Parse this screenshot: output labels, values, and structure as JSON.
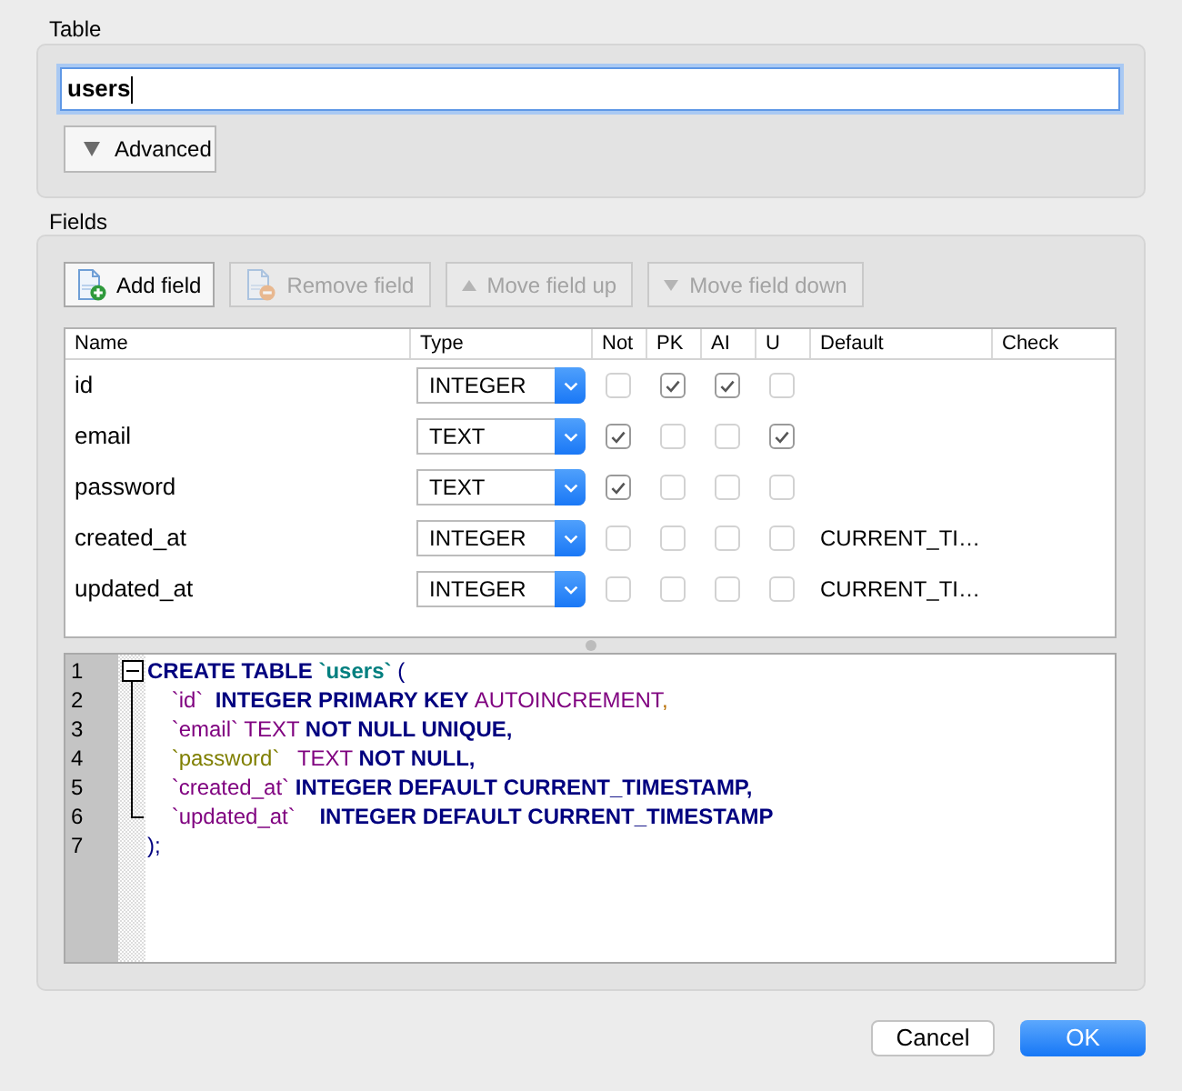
{
  "table_section": {
    "label": "Table",
    "name_field": {
      "value": "users",
      "focused": true
    },
    "advanced_button": {
      "label": "Advanced"
    }
  },
  "fields_section": {
    "label": "Fields",
    "toolbar": [
      {
        "kind": "add",
        "label": "Add field",
        "disabled": false
      },
      {
        "kind": "remove",
        "label": "Remove field",
        "disabled": true
      },
      {
        "kind": "up",
        "label": "Move field up",
        "disabled": true
      },
      {
        "kind": "down",
        "label": "Move field down",
        "disabled": true
      }
    ],
    "columns": [
      "Name",
      "Type",
      "Not",
      "PK",
      "AI",
      "U",
      "Default",
      "Check"
    ],
    "rows": [
      {
        "name": "id",
        "type": "INTEGER",
        "not_null": false,
        "pk": true,
        "ai": true,
        "unique": false
      },
      {
        "name": "email",
        "type": "TEXT",
        "not_null": true,
        "pk": false,
        "ai": false,
        "unique": true
      },
      {
        "name": "password",
        "type": "TEXT",
        "not_null": true,
        "pk": false,
        "ai": false,
        "unique": false
      },
      {
        "name": "created_at",
        "type": "INTEGER",
        "not_null": false,
        "pk": false,
        "ai": false,
        "unique": false,
        "default": "CURRENT_TI…"
      },
      {
        "name": "updated_at",
        "type": "INTEGER",
        "not_null": false,
        "pk": false,
        "ai": false,
        "unique": false,
        "default": "CURRENT_TI…"
      }
    ]
  },
  "sql_editor": {
    "fold_expanded": true,
    "lines": [
      {
        "number": "1",
        "tokens": [
          {
            "kind": "keyword",
            "text": "CREATE TABLE "
          },
          {
            "kind": "table",
            "text": "`users`"
          },
          {
            "kind": "operator",
            "text": " ("
          }
        ]
      },
      {
        "number": "2",
        "tokens": [
          {
            "kind": "identifier",
            "text": "    `id`"
          },
          {
            "kind": "keyword",
            "text": "  INTEGER PRIMARY KEY "
          },
          {
            "kind": "type",
            "text": "AUTOINCREMENT"
          },
          {
            "kind": "comma",
            "text": ","
          }
        ]
      },
      {
        "number": "3",
        "tokens": [
          {
            "kind": "identifier",
            "text": "    `email`"
          },
          {
            "kind": "type",
            "text": " TEXT "
          },
          {
            "kind": "keyword",
            "text": "NOT NULL UNIQUE,"
          }
        ]
      },
      {
        "number": "4",
        "tokens": [
          {
            "kind": "quoted",
            "text": "    `password`"
          },
          {
            "kind": "type",
            "text": "   TEXT "
          },
          {
            "kind": "keyword",
            "text": "NOT NULL,"
          }
        ]
      },
      {
        "number": "5",
        "tokens": [
          {
            "kind": "identifier",
            "text": "    `created_at`"
          },
          {
            "kind": "keyword",
            "text": " INTEGER DEFAULT CURRENT_TIMESTAMP,"
          }
        ]
      },
      {
        "number": "6",
        "tokens": [
          {
            "kind": "identifier",
            "text": "    `updated_at`"
          },
          {
            "kind": "keyword",
            "text": "    INTEGER DEFAULT CURRENT_TIMESTAMP"
          }
        ]
      },
      {
        "number": "7",
        "tokens": [
          {
            "kind": "operator",
            "text": ");"
          }
        ]
      }
    ]
  },
  "buttons": [
    {
      "label": "Cancel",
      "default": false
    },
    {
      "label": "OK",
      "default": true
    }
  ]
}
